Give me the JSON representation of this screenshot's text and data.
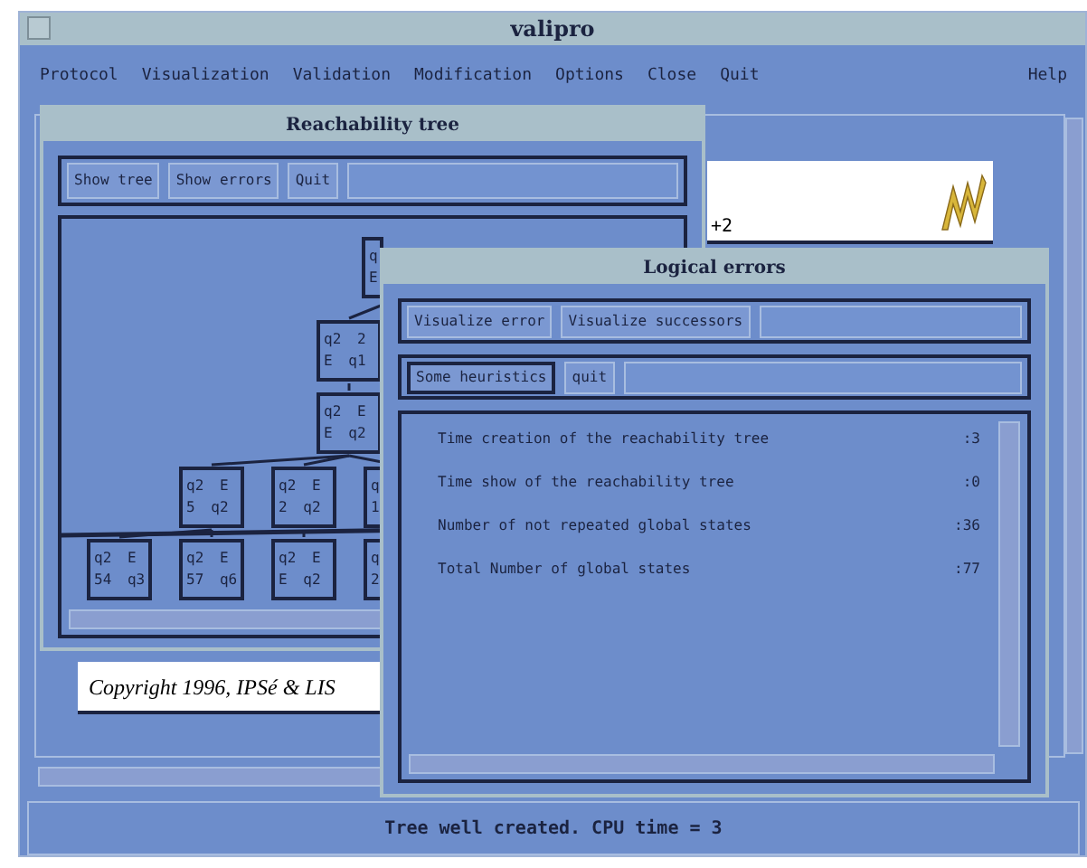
{
  "window": {
    "title": "valipro"
  },
  "menu": [
    "Protocol",
    "Visualization",
    "Validation",
    "Modification",
    "Options",
    "Close",
    "Quit"
  ],
  "help_menu": "Help",
  "background_panel": {
    "text": "+2"
  },
  "copyright": "Copyright 1996, IPSé & LIS",
  "reachability_window": {
    "title": "Reachability tree",
    "buttons": [
      "Show tree",
      "Show errors",
      "Quit"
    ],
    "tree": {
      "lines": [
        "q",
        "E"
      ],
      "children": [
        {
          "lines": [
            "q2 2",
            "E q1"
          ],
          "children": [
            {
              "lines": [
                "q2 E",
                "E q2"
              ],
              "children": [
                {
                  "lines": [
                    "q2 E",
                    "5 q2"
                  ],
                  "children": [
                    {
                      "lines": [
                        "q2 E",
                        "54 q3"
                      ]
                    },
                    {
                      "lines": [
                        "q2 E",
                        "57 q6"
                      ]
                    }
                  ]
                },
                {
                  "lines": [
                    "q2 E",
                    "2 q2"
                  ],
                  "children": [
                    {
                      "lines": [
                        "q2 E",
                        "E q2"
                      ]
                    }
                  ]
                },
                {
                  "lines": [
                    "q",
                    "1"
                  ],
                  "children": [
                    {
                      "lines": [
                        "q",
                        "2"
                      ]
                    }
                  ]
                }
              ]
            }
          ]
        }
      ]
    }
  },
  "logical_errors_window": {
    "title": "Logical errors",
    "toolbar_1": [
      {
        "label": "Visualize error",
        "selected": false
      },
      {
        "label": "Visualize successors",
        "selected": false
      }
    ],
    "toolbar_2": [
      {
        "label": "Some heuristics",
        "selected": true
      },
      {
        "label": "quit",
        "selected": false
      }
    ],
    "rows": [
      {
        "label": "Time creation of the reachability tree",
        "value": ":3"
      },
      {
        "label": "Time show of the reachability tree",
        "value": ":0"
      },
      {
        "label": "Number of not repeated global states",
        "value": ":36"
      },
      {
        "label": "Total Number of global states",
        "value": ":77"
      }
    ]
  },
  "status_bar": "Tree well created. CPU time = 3"
}
